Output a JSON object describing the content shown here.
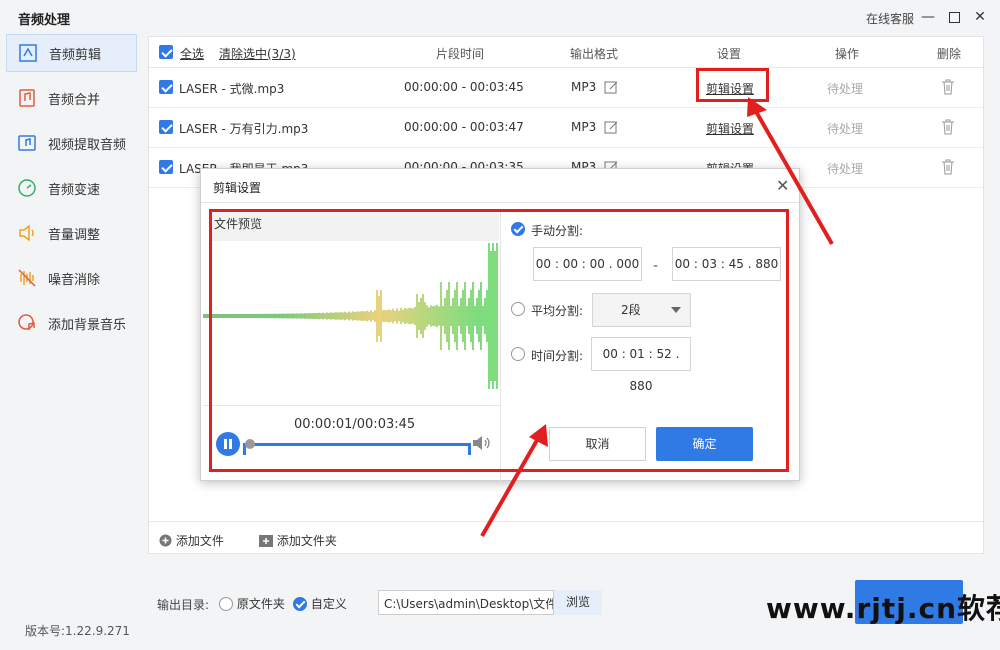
{
  "app": {
    "title": "音频处理",
    "online_service": "在线客服",
    "version": "版本号:1.22.9.271"
  },
  "sidebar": {
    "items": [
      {
        "label": "音频剪辑",
        "icon": "audio-cut-icon",
        "active": true
      },
      {
        "label": "音频合并",
        "icon": "audio-merge-icon",
        "active": false
      },
      {
        "label": "视频提取音频",
        "icon": "video-extract-icon",
        "active": false
      },
      {
        "label": "音频变速",
        "icon": "speed-icon",
        "active": false
      },
      {
        "label": "音量调整",
        "icon": "volume-icon",
        "active": false
      },
      {
        "label": "噪音消除",
        "icon": "noise-icon",
        "active": false
      },
      {
        "label": "添加背景音乐",
        "icon": "bgm-icon",
        "active": false
      }
    ]
  },
  "table": {
    "select_all": "全选",
    "clear_selection": "清除选中(3/3)",
    "headers": {
      "segment_time": "片段时间",
      "output_format": "输出格式",
      "settings": "设置",
      "action": "操作",
      "delete": "删除"
    },
    "rows": [
      {
        "name": "LASER - 式微.mp3",
        "time": "00:00:00 - 00:03:45",
        "format": "MP3",
        "settings": "剪辑设置",
        "status": "待处理"
      },
      {
        "name": "LASER - 万有引力.mp3",
        "time": "00:00:00 - 00:03:47",
        "format": "MP3",
        "settings": "剪辑设置",
        "status": "待处理"
      },
      {
        "name": "LASER - 我即是王.mp3",
        "time": "00:00:00 - 00:03:35",
        "format": "MP3",
        "settings": "剪辑设置",
        "status": "待处理"
      }
    ]
  },
  "footer": {
    "add_file": "添加文件",
    "add_folder": "添加文件夹",
    "output_dir_label": "输出目录:",
    "option_original": "原文件夹",
    "option_custom": "自定义",
    "path": "C:\\Users\\admin\\Desktop\\文件",
    "browse": "浏览"
  },
  "dialog": {
    "title": "剪辑设置",
    "preview_label": "文件预览",
    "playback_time": "00:00:01/00:03:45",
    "playback_progress": 0.004,
    "manual_split": "手动分割:",
    "manual_start": "00 : 00 : 00 . 000",
    "manual_end": "00 : 03 : 45 . 880",
    "dash": "-",
    "even_split": "平均分割:",
    "even_value": "2段",
    "time_split": "时间分割:",
    "time_value": "00 : 01 : 52 . 880",
    "cancel": "取消",
    "confirm": "确定"
  },
  "watermark": "www.rjtj.cn软荐网",
  "colors": {
    "accent": "#2f7ae5",
    "annotation": "#e21f1f"
  }
}
